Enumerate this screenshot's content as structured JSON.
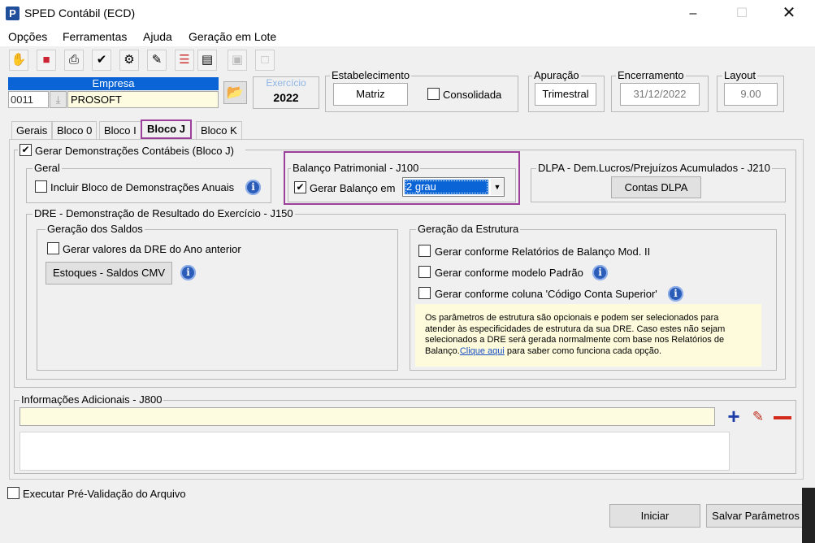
{
  "window": {
    "title": "SPED Contábil (ECD)",
    "icon_letter": "P"
  },
  "menu": [
    "Opções",
    "Ferramentas",
    "Ajuda",
    "Geração em Lote"
  ],
  "toolbar_icons": [
    "hand-icon",
    "tree-icon",
    "printer-icon",
    "check-icon",
    "gears-icon",
    "edit-icon",
    "list-icon",
    "document-icon",
    "cube-icon",
    "disabled-icon"
  ],
  "empresa": {
    "label": "Empresa",
    "code": "0011",
    "name": "PROSOFT"
  },
  "exercicio": {
    "label": "Exercício",
    "value": "2022"
  },
  "estabelecimento": {
    "label": "Estabelecimento",
    "value": "Matriz",
    "consolidada_label": "Consolidada"
  },
  "apuracao": {
    "label": "Apuração",
    "value": "Trimestral"
  },
  "encerramento": {
    "label": "Encerramento",
    "value": "31/12/2022"
  },
  "layout": {
    "label": "Layout",
    "value": "9.00"
  },
  "tabs": [
    "Gerais",
    "Bloco 0",
    "Bloco I",
    "Bloco J",
    "Bloco K"
  ],
  "active_tab": "Bloco J",
  "bloco_j": {
    "gerar_label": "Gerar Demonstrações Contábeis (Bloco J)",
    "geral": {
      "label": "Geral",
      "incluir_label": "Incluir Bloco de Demonstrações Anuais"
    },
    "balanco": {
      "label": "Balanço Patrimonial - J100",
      "gerar_label": "Gerar Balanço em",
      "grau_value": "2 grau"
    },
    "dlpa": {
      "label": "DLPA - Dem.Lucros/Prejuízos Acumulados - J210",
      "button": "Contas DLPA"
    },
    "dre": {
      "label": "DRE - Demonstração de Resultado do Exercício - J150",
      "saldos": {
        "label": "Geração dos Saldos",
        "gerar_label": "Gerar valores da DRE do Ano anterior",
        "button": "Estoques - Saldos CMV"
      },
      "estrutura": {
        "label": "Geração da Estrutura",
        "options": [
          "Gerar conforme Relatórios de Balanço Mod. II",
          "Gerar conforme modelo Padrão",
          "Gerar conforme coluna 'Código Conta Superior'"
        ],
        "note_lines": [
          "Os parâmetros de estrutura são opcionais e podem ser selecionados para",
          "atender às especificidades de estrutura da sua DRE. Caso estes não sejam",
          "selecionados a DRE será gerada normalmente com base nos Relatórios de"
        ],
        "note_last_prefix": "Balanço.",
        "note_link": "Clique aqui",
        "note_last_suffix": " para saber como funciona cada opção."
      }
    }
  },
  "info_adicionais": {
    "label": "Informações Adicionais - J800"
  },
  "pre_validacao_label": "Executar Pré-Validação do Arquivo",
  "buttons": {
    "iniciar": "Iniciar",
    "salvar": "Salvar Parâmetros"
  },
  "colors": {
    "highlight_border": "#9b3f9b",
    "selection": "#0a64d6",
    "note_bg": "#fefbdc",
    "input_yellow": "#fefce0"
  }
}
